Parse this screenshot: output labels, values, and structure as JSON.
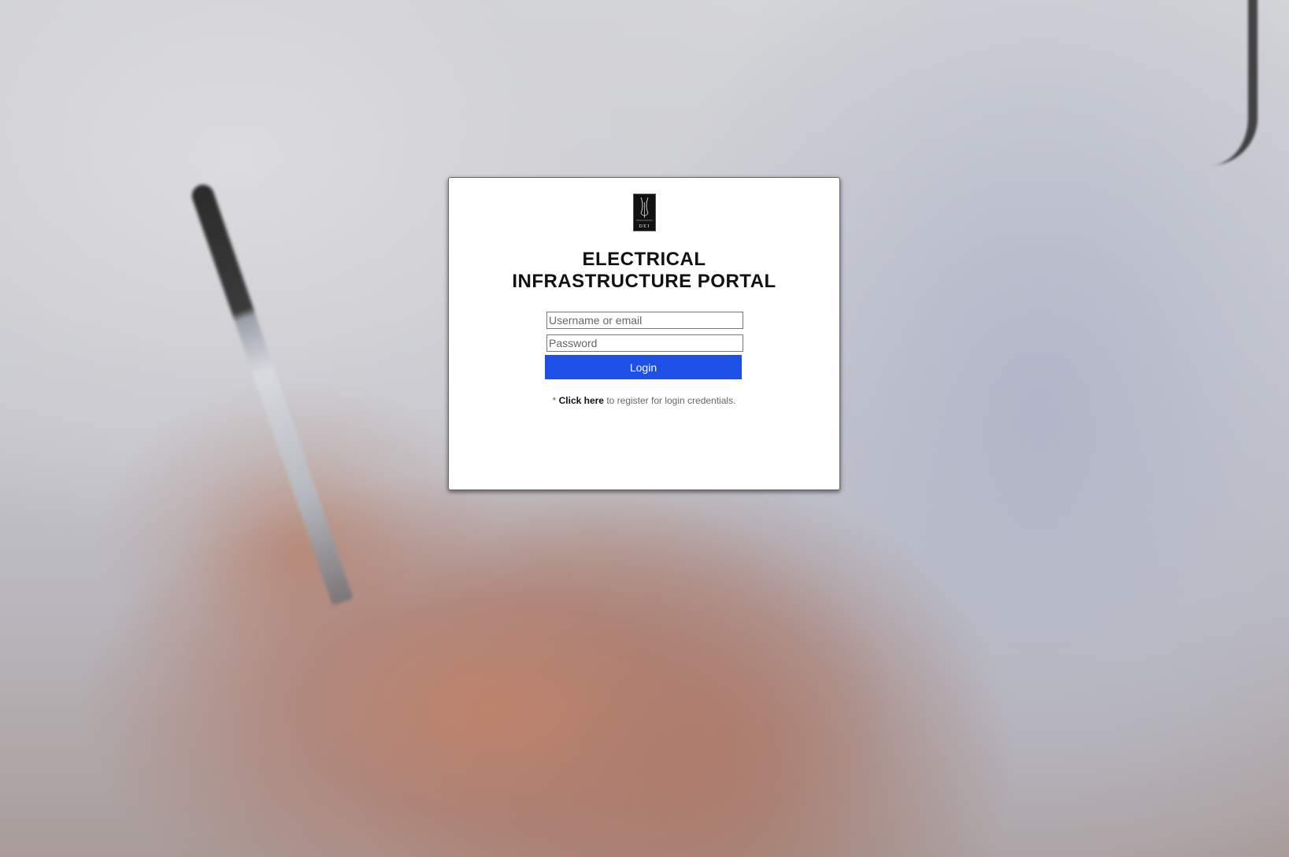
{
  "login": {
    "title": "ELECTRICAL INFRASTRUCTURE PORTAL",
    "logo_text": "DEI",
    "username_placeholder": "Username or email",
    "password_placeholder": "Password",
    "login_label": "Login",
    "register_prefix": "* ",
    "register_link": "Click here",
    "register_suffix": " to register for login credentials."
  },
  "colors": {
    "accent": "#1c50e6",
    "card_background": "#ffffff"
  }
}
